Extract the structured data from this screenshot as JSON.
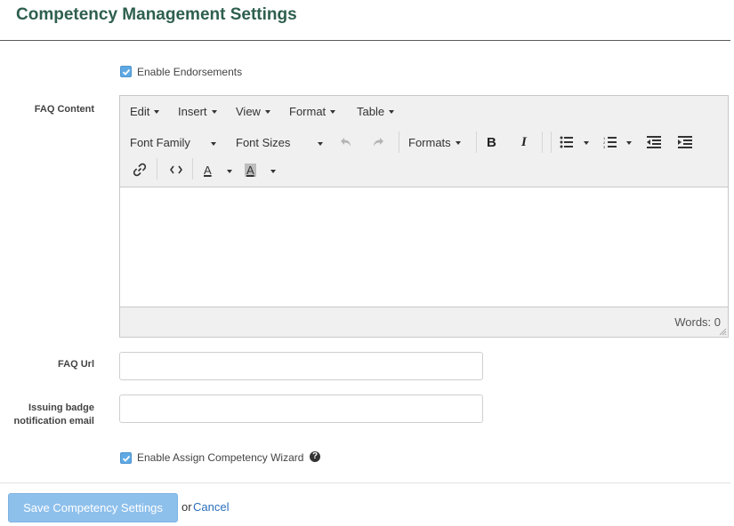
{
  "page": {
    "title": "Competency Management Settings"
  },
  "endorsements": {
    "label": "Enable Endorsements",
    "checked": true
  },
  "faq_content": {
    "label": "FAQ Content",
    "menubar": [
      "Edit",
      "Insert",
      "View",
      "Format",
      "Table"
    ],
    "toolbar": {
      "font_family": "Font Family",
      "font_sizes": "Font Sizes",
      "formats": "Formats",
      "bold": "B",
      "italic": "I",
      "font_color_glyph": "A",
      "bg_color_glyph": "A"
    },
    "word_count": "Words: 0"
  },
  "faq_url": {
    "label": "FAQ Url",
    "value": "",
    "placeholder": ""
  },
  "badge_email": {
    "label_line1": "Issuing badge",
    "label_line2": "notification email",
    "value": "",
    "placeholder": ""
  },
  "assign_wizard": {
    "label": "Enable Assign Competency Wizard",
    "checked": true,
    "help_glyph": "?"
  },
  "footer": {
    "save_label": "Save Competency Settings",
    "or_text": "or",
    "cancel_label": "Cancel"
  },
  "colors": {
    "title": "#2e5f4f",
    "accent": "#5ea9e3",
    "button": "#8ec0ec",
    "link": "#2a6ebb"
  }
}
